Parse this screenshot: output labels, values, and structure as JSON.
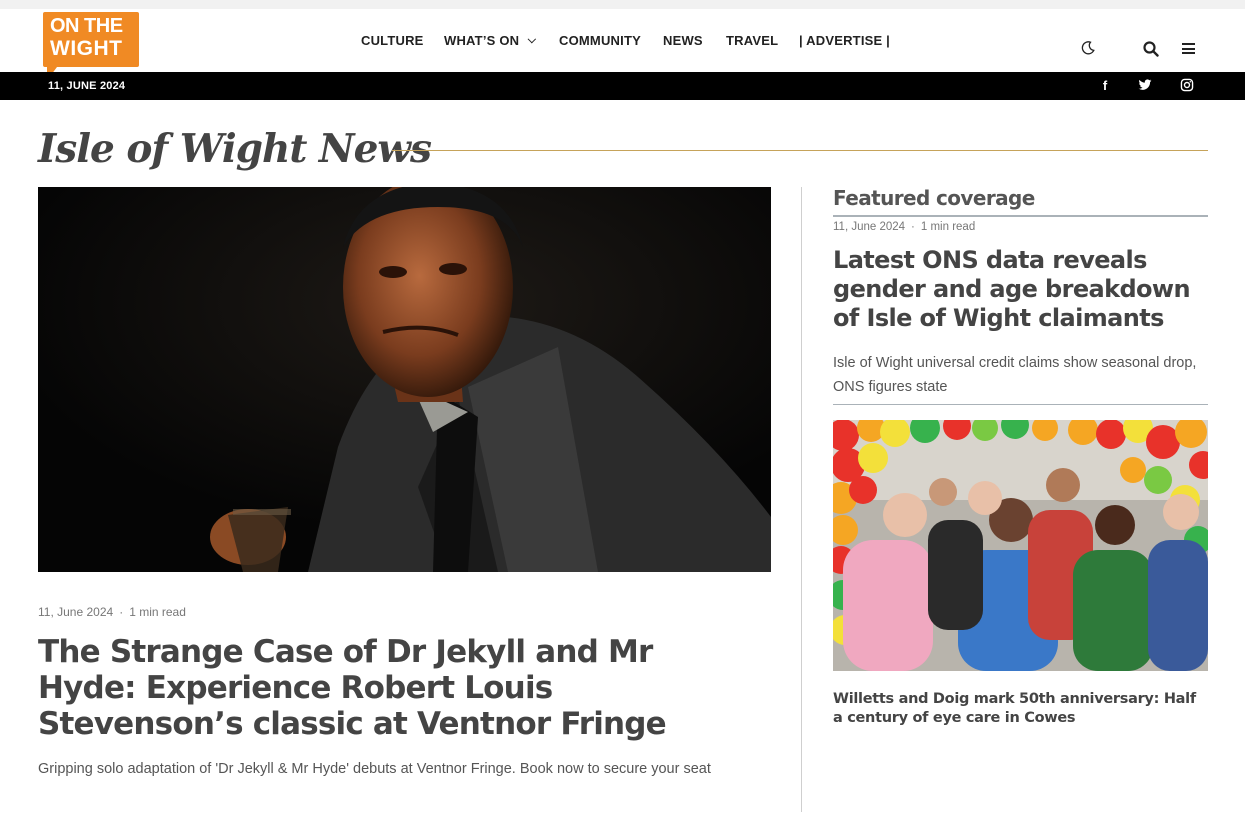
{
  "brand": {
    "logo_line1": "ON THE",
    "logo_line2": "WIGHT",
    "accent": "#f08a24"
  },
  "nav": {
    "items": [
      {
        "label": "CULTURE"
      },
      {
        "label": "WHAT’S ON",
        "dropdown": true
      },
      {
        "label": "COMMUNITY"
      },
      {
        "label": "NEWS"
      },
      {
        "label": "TRAVEL"
      },
      {
        "label": "| ADVERTISE |"
      }
    ],
    "icons": [
      "moon-icon",
      "search-icon",
      "menu-icon"
    ]
  },
  "topbar": {
    "date": "11, JUNE 2024",
    "social": [
      {
        "name": "facebook-icon",
        "glyph": "f"
      },
      {
        "name": "twitter-icon",
        "glyph": "t"
      },
      {
        "name": "instagram-icon",
        "glyph": ""
      }
    ]
  },
  "section_title": "Isle of Wight News",
  "main_article": {
    "date": "11, June 2024",
    "read_time": "1 min read",
    "separator": "·",
    "title": "The Strange Case of Dr Jekyll and Mr Hyde: Experience Robert Louis Stevenson’s classic at Ventnor Fringe",
    "excerpt": "Gripping solo adaptation of 'Dr Jekyll & Mr Hyde' debuts at Ventnor Fringe. Book now to secure your seat"
  },
  "featured": {
    "heading": "Featured coverage",
    "article": {
      "date": "11, June 2024",
      "read_time": "1 min read",
      "separator": "·",
      "title": "Latest ONS data reveals gender and age breakdown of Isle of Wight claimants",
      "excerpt": "Isle of Wight universal credit claims show seasonal drop, ONS figures state"
    },
    "secondary": {
      "title": "Willetts and Doig mark 50th anniversary: Half a century of eye care in Cowes"
    }
  },
  "colors": {
    "title_rule": "#c6a35a",
    "text_dark": "#444444",
    "black_bar": "#000000"
  }
}
